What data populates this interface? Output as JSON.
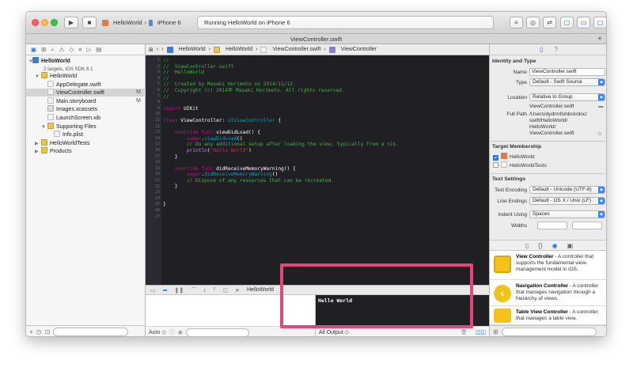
{
  "toolbar": {
    "scheme_project": "HelloWorld",
    "scheme_device": "iPhone 6",
    "status": "Running HelloWorld on iPhone 6"
  },
  "tab_title": "ViewController.swift",
  "navigator": {
    "project_name": "HelloWorld",
    "project_sub": "2 targets, iOS SDK 8.1",
    "items": [
      {
        "label": "HelloWorld",
        "indent": 1,
        "icon": "folder",
        "tri": "▼",
        "mod": ""
      },
      {
        "label": "AppDelegate.swift",
        "indent": 2,
        "icon": "swift",
        "tri": "",
        "mod": ""
      },
      {
        "label": "ViewController.swift",
        "indent": 2,
        "icon": "swift",
        "tri": "",
        "mod": "M",
        "selected": true
      },
      {
        "label": "Main.storyboard",
        "indent": 2,
        "icon": "sb",
        "tri": "",
        "mod": "M"
      },
      {
        "label": "Images.xcassets",
        "indent": 2,
        "icon": "asset",
        "tri": "",
        "mod": ""
      },
      {
        "label": "LaunchScreen.xib",
        "indent": 2,
        "icon": "sb",
        "tri": "",
        "mod": ""
      },
      {
        "label": "Supporting Files",
        "indent": 2,
        "icon": "folder",
        "tri": "▼",
        "mod": ""
      },
      {
        "label": "Info.plist",
        "indent": 3,
        "icon": "sb",
        "tri": "",
        "mod": ""
      },
      {
        "label": "HelloWorldTests",
        "indent": 1,
        "icon": "folder",
        "tri": "▶",
        "mod": ""
      },
      {
        "label": "Products",
        "indent": 1,
        "icon": "folder",
        "tri": "▶",
        "mod": ""
      }
    ]
  },
  "jumpbar": {
    "crumbs": [
      "HelloWorld",
      "HelloWorld",
      "ViewController.swift",
      "ViewController"
    ]
  },
  "code_lines": [
    [
      [
        "c",
        "//"
      ]
    ],
    [
      [
        "c",
        "//  ViewController.swift"
      ]
    ],
    [
      [
        "c",
        "//  HelloWorld"
      ]
    ],
    [
      [
        "c",
        "//"
      ]
    ],
    [
      [
        "c",
        "//  Created by Masaki Horimoto on 2014/11/12."
      ]
    ],
    [
      [
        "c",
        "//  Copyright (c) 2014年 Masaki Horimoto. All rights reserved."
      ]
    ],
    [
      [
        "c",
        "//"
      ]
    ],
    [
      [
        "",
        ""
      ]
    ],
    [
      [
        "k",
        "import"
      ],
      [
        "",
        " UIKit"
      ]
    ],
    [
      [
        "",
        ""
      ]
    ],
    [
      [
        "k",
        "class"
      ],
      [
        "",
        " ViewController: "
      ],
      [
        "t",
        "UIViewController"
      ],
      [
        "",
        " {"
      ]
    ],
    [
      [
        "",
        ""
      ]
    ],
    [
      [
        "",
        "    "
      ],
      [
        "k",
        "override"
      ],
      [
        "",
        " "
      ],
      [
        "k",
        "func"
      ],
      [
        "",
        " viewDidLoad() {"
      ]
    ],
    [
      [
        "",
        "        "
      ],
      [
        "k",
        "super"
      ],
      [
        "",
        "."
      ],
      [
        "t",
        "viewDidLoad"
      ],
      [
        "",
        "()"
      ]
    ],
    [
      [
        "",
        "        "
      ],
      [
        "c",
        "// Do any additional setup after loading the view, typically from a nib."
      ]
    ],
    [
      [
        "",
        "        "
      ],
      [
        "p",
        "println"
      ],
      [
        "",
        "("
      ],
      [
        "s",
        "\"Hello World\""
      ],
      [
        "",
        ")"
      ]
    ],
    [
      [
        "",
        "    }"
      ]
    ],
    [
      [
        "",
        ""
      ]
    ],
    [
      [
        "",
        "    "
      ],
      [
        "k",
        "override"
      ],
      [
        "",
        " "
      ],
      [
        "k",
        "func"
      ],
      [
        "",
        " didReceiveMemoryWarning() {"
      ]
    ],
    [
      [
        "",
        "        "
      ],
      [
        "k",
        "super"
      ],
      [
        "",
        "."
      ],
      [
        "t",
        "didReceiveMemoryWarning"
      ],
      [
        "",
        "()"
      ]
    ],
    [
      [
        "",
        "        "
      ],
      [
        "c",
        "// Dispose of any resources that can be recreated."
      ]
    ],
    [
      [
        "",
        "    }"
      ]
    ],
    [
      [
        "",
        ""
      ]
    ],
    [
      [
        "",
        ""
      ]
    ],
    [
      [
        "",
        "}"
      ]
    ],
    [
      [
        "",
        ""
      ]
    ],
    [
      [
        "",
        ""
      ]
    ]
  ],
  "debug": {
    "target_label": "HelloWorld",
    "auto_label": "Auto ◇",
    "console_output": "Hello World",
    "output_selector": "All Output ◇"
  },
  "inspector": {
    "identity_title": "Identity and Type",
    "name_label": "Name",
    "name_value": "ViewController.swift",
    "type_label": "Type",
    "type_value": "Default - Swift Source",
    "location_label": "Location",
    "location_value": "Relative to Group",
    "location_file": "ViewController.swift",
    "fullpath_label": "Full Path",
    "fullpath_lines": [
      "/Users/dydrmfishbck/doc/",
      "swift/HelloWorld/",
      "HelloWorld/",
      "ViewController.swift"
    ],
    "membership_title": "Target Membership",
    "target1": "HelloWorld",
    "target2": "HelloWorldTests",
    "text_settings_title": "Text Settings",
    "encoding_label": "Text Encoding",
    "encoding_value": "Default - Unicode (UTF-8)",
    "endings_label": "Line Endings",
    "endings_value": "Default - OS X / Unix (LF)",
    "indent_label": "Indent Using",
    "indent_value": "Spaces",
    "widths_label": "Widths",
    "library": [
      {
        "title": "View Controller",
        "desc": " - A controller that supports the fundamental view-management model in iOS.",
        "color": "#f4c21b"
      },
      {
        "title": "Navigation Controller",
        "desc": " - A controller that manages navigation through a hierarchy of views.",
        "color": "#f4c21b"
      },
      {
        "title": "Table View Controller",
        "desc": " - A controller that manages a table view.",
        "color": "#f4c21b"
      }
    ]
  }
}
